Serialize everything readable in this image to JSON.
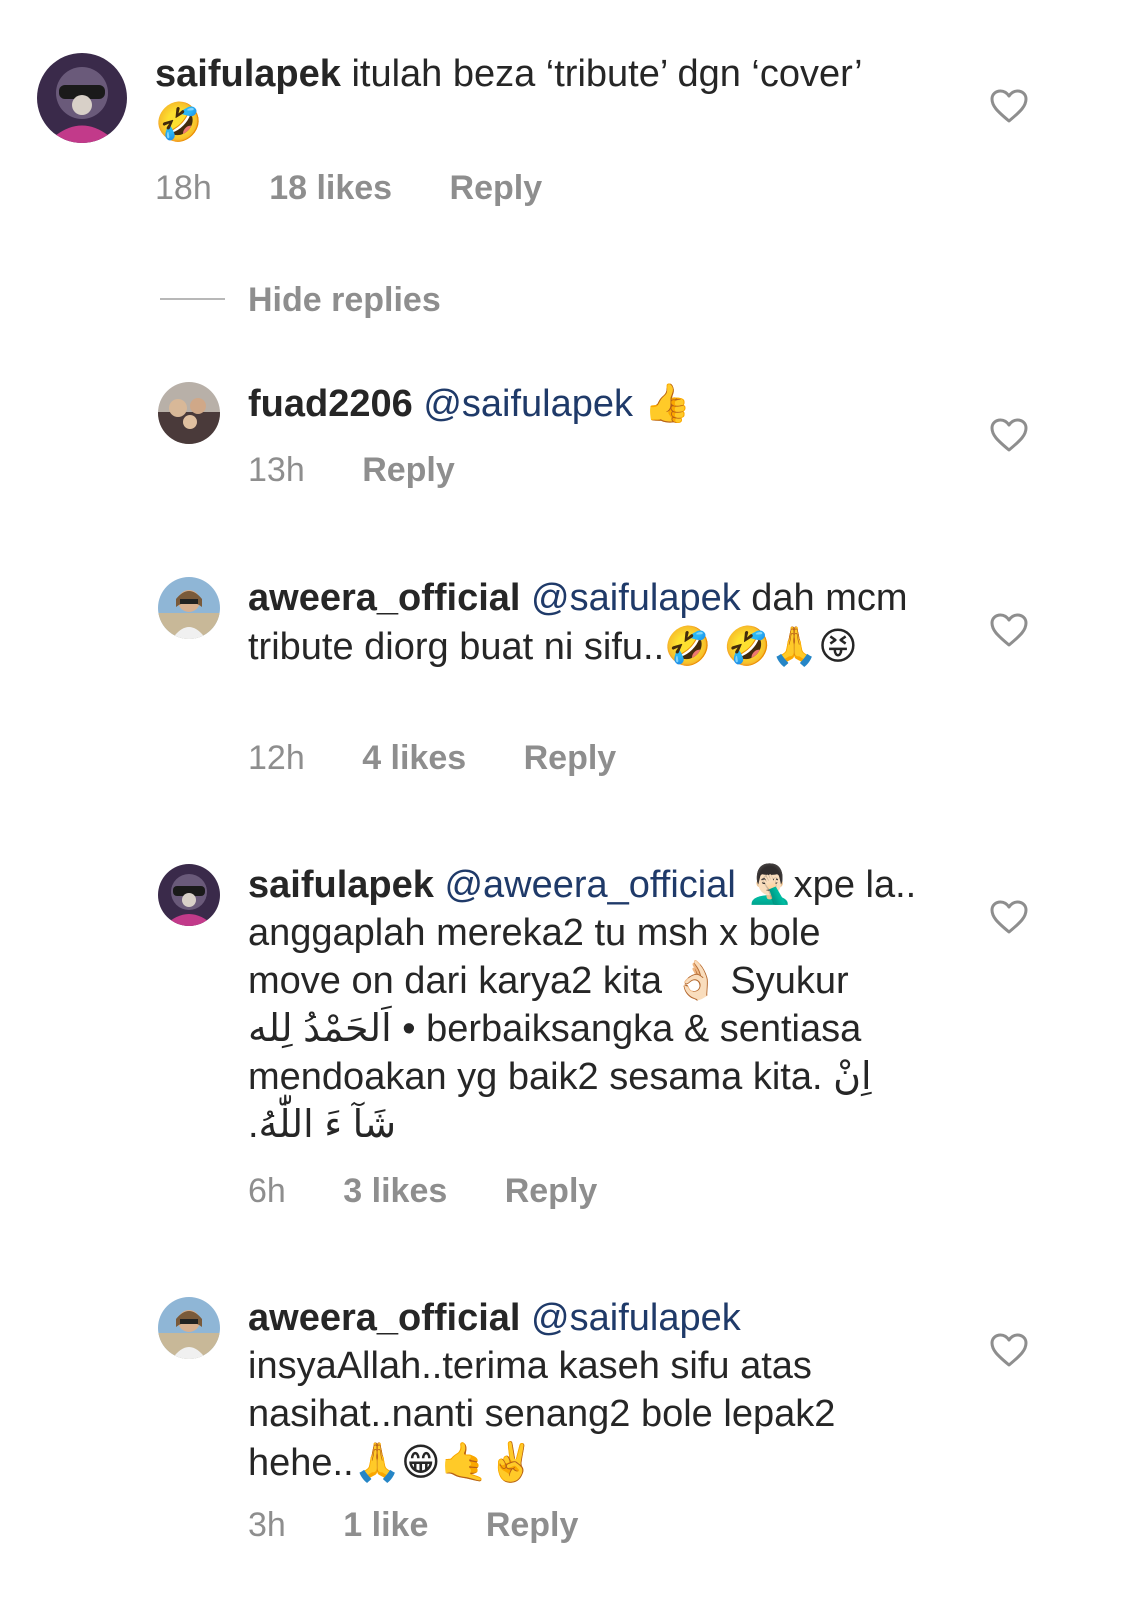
{
  "comments": [
    {
      "username": "saifulapek",
      "mention": "",
      "text": "itulah beza ‘tribute’ dgn ‘cover’ ",
      "emoji": "🤣",
      "time": "18h",
      "likes": "18 likes",
      "reply_label": "Reply"
    },
    {
      "username": "fuad2206",
      "mention": "@saifulapek",
      "text": " ",
      "emoji": "👍",
      "time": "13h",
      "likes": "",
      "reply_label": "Reply"
    },
    {
      "username": "aweera_official",
      "mention": "@saifulapek",
      "text": " dah mcm tribute diorg buat ni sifu..",
      "emoji": "🤣 🤣🙏😝",
      "time": "12h",
      "likes": "4 likes",
      "reply_label": "Reply"
    },
    {
      "username": "saifulapek",
      "mention": "@aweera_official",
      "text_1": " 🤦🏻‍♂️xpe la.. anggaplah mereka2 tu msh x bole move on dari karya2 kita 👌🏻 Syukur ",
      "arabic_1": "اَلحَمْدُ لِله",
      "text_2": " • berbaiksangka & sentiasa mendoakan yg baik2 sesama kita. ",
      "arabic_2": "اِنْ شَآ ءَ اللّٰهُ.",
      "time": "6h",
      "likes": "3 likes",
      "reply_label": "Reply"
    },
    {
      "username": "aweera_official",
      "mention": "@saifulapek",
      "text": " insyaAllah..terima kaseh sifu atas nasihat..nanti senang2 bole lepak2 hehe..",
      "emoji": "🙏😁🤙✌️",
      "time": "3h",
      "likes": "1 like",
      "reply_label": "Reply"
    }
  ],
  "hide_replies_label": "Hide replies",
  "colors": {
    "text": "#262626",
    "meta": "#8e8e8e",
    "mention": "#1f3a69"
  },
  "icons": {
    "like": "heart-outline-icon"
  }
}
